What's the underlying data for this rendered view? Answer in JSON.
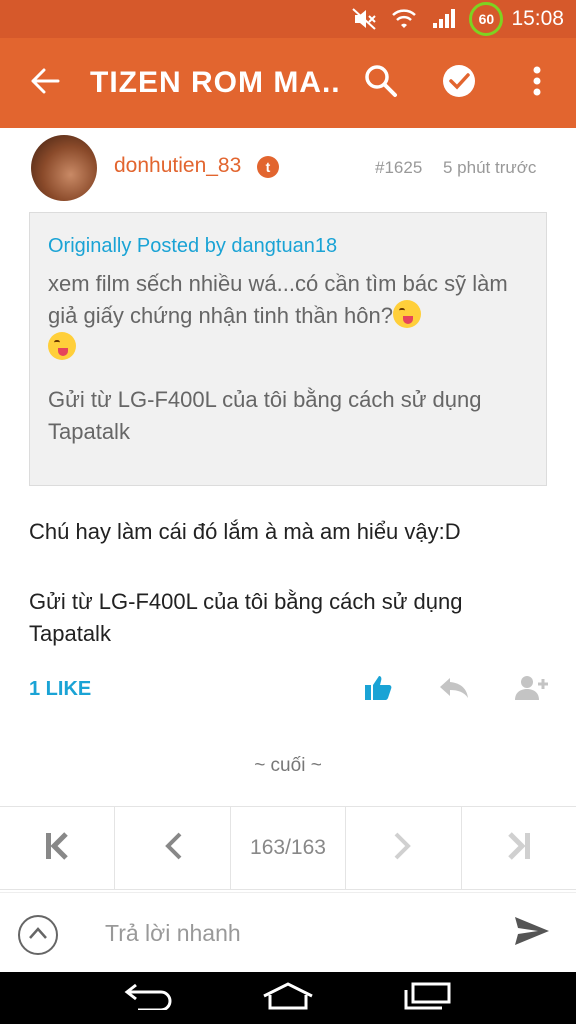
{
  "status_bar": {
    "battery_level": "60",
    "time": "15:08",
    "icons": [
      "mute-icon",
      "wifi-icon",
      "signal-icon"
    ]
  },
  "app_bar": {
    "title": "TIZEN ROM MA...",
    "icons": [
      "back-arrow-icon",
      "search-icon",
      "check-circle-icon",
      "overflow-menu-icon"
    ]
  },
  "post": {
    "username": "donhutien_83",
    "badge": "t",
    "number": "#1625",
    "time": "5 phút trước",
    "quote": {
      "posted_by": "Originally Posted by dangtuan18",
      "text": "xem film sếch nhiều wá...có cần tìm bác sỹ làm giả giấy chứng nhận tinh thần hôn?",
      "signature": "Gửi từ LG-F400L của tôi bằng cách sử dụng Tapatalk"
    },
    "body": "Chú hay làm cái đó lắm à mà am hiểu vậy:D",
    "signature": "Gửi từ LG-F400L của tôi bằng cách sử dụng Tapatalk",
    "likes": "1 LIKE"
  },
  "end_label": "~ cuối ~",
  "pager": {
    "current": "163/163"
  },
  "reply": {
    "placeholder": "Trả lời nhanh"
  },
  "colors": {
    "accent": "#e2652f",
    "status_bar": "#d6592b",
    "link": "#1aa3d5"
  }
}
